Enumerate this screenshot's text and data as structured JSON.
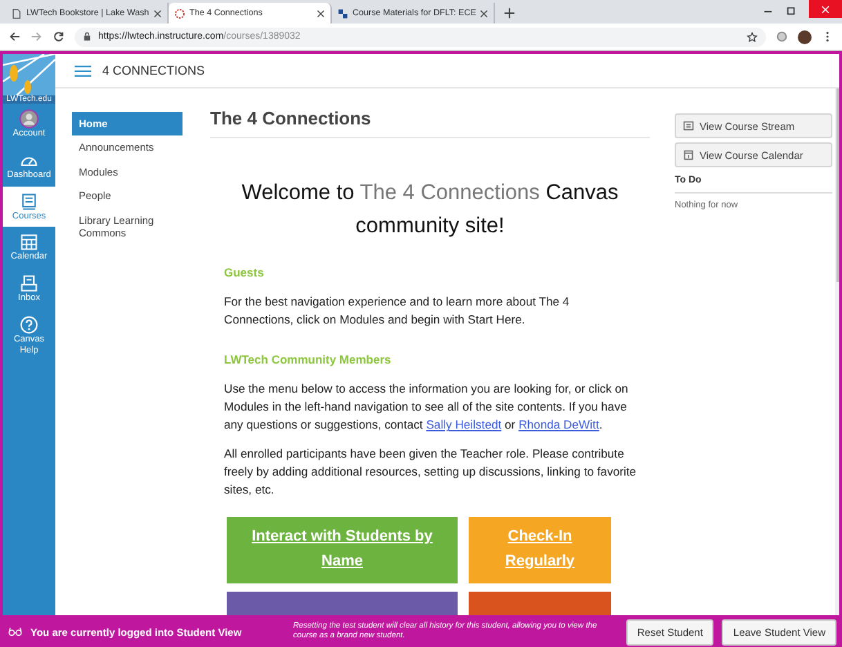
{
  "browser": {
    "tabs": [
      {
        "title": "LWTech Bookstore | Lake Wash",
        "selected": false
      },
      {
        "title": "The 4 Connections",
        "selected": true
      },
      {
        "title": "Course Materials for DFLT: ECE",
        "selected": false
      }
    ],
    "url_host": "https://lwtech.instructure.com",
    "url_path": "/courses/1389032"
  },
  "logo_text": "LWTech.edu",
  "global_nav": [
    {
      "label": "Account",
      "selected": false
    },
    {
      "label": "Dashboard",
      "selected": false
    },
    {
      "label": "Courses",
      "selected": true
    },
    {
      "label": "Calendar",
      "selected": false
    },
    {
      "label": "Inbox",
      "selected": false
    },
    {
      "label": "Canvas Help",
      "selected": false
    }
  ],
  "breadcrumb": "4 CONNECTIONS",
  "course_nav": [
    {
      "label": "Home",
      "selected": true
    },
    {
      "label": "Announcements",
      "selected": false
    },
    {
      "label": "Modules",
      "selected": false
    },
    {
      "label": "People",
      "selected": false
    },
    {
      "label": "Library Learning Commons",
      "selected": false
    }
  ],
  "page_title": "The 4 Connections",
  "welcome": {
    "before": "Welcome to",
    "highlight": "The 4 Connections",
    "after": "Canvas community site!"
  },
  "sections": [
    {
      "heading": "Guests",
      "paragraphs": [
        {
          "text": "For the best navigation experience and to learn more about The 4 Connections, click on Modules and begin with Start Here."
        }
      ]
    },
    {
      "heading": "LWTech Community Members",
      "paragraphs": [
        {
          "text": "Use the menu below to access the information you are looking for, or click on Modules in the left-hand navigation to see all of the site contents. If you have any questions or suggestions, contact",
          "link_1": "Sally Heilstedt",
          "between": "or",
          "link_2": "Rhonda DeWitt",
          "after": "."
        },
        {
          "text": "All enrolled participants have been given the Teacher role. Please contribute freely by adding additional resources, setting up discussions, linking to favorite sites, etc."
        }
      ]
    }
  ],
  "tiles": [
    {
      "label": "Interact with Students by Name",
      "color": "#6db33f"
    },
    {
      "label": "Check-In Regularly",
      "color": "#f5a623"
    },
    {
      "color": "#6a5aa8"
    },
    {
      "color": "#d9531e"
    }
  ],
  "sidebar": {
    "buttons": [
      {
        "label": "View Course Stream"
      },
      {
        "label": "View Course Calendar"
      }
    ],
    "todo_heading": "To Do",
    "todo_empty": "Nothing for now"
  },
  "student_view": {
    "message": "You are currently logged into Student View",
    "note": "Resetting the test student will clear all history for this student, allowing you to view the course as a brand new student.",
    "buttons": [
      "Reset Student",
      "Leave Student View"
    ]
  }
}
